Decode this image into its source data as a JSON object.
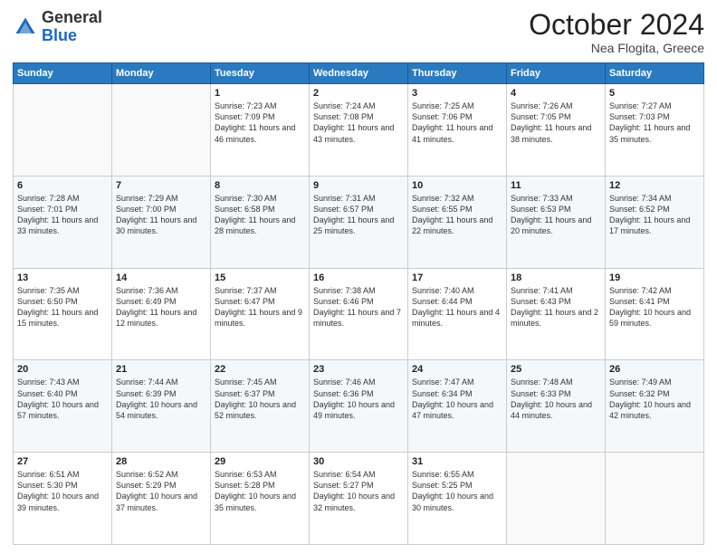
{
  "header": {
    "logo_general": "General",
    "logo_blue": "Blue",
    "month": "October 2024",
    "location": "Nea Flogita, Greece"
  },
  "weekdays": [
    "Sunday",
    "Monday",
    "Tuesday",
    "Wednesday",
    "Thursday",
    "Friday",
    "Saturday"
  ],
  "weeks": [
    [
      {
        "day": "",
        "info": ""
      },
      {
        "day": "",
        "info": ""
      },
      {
        "day": "1",
        "info": "Sunrise: 7:23 AM\nSunset: 7:09 PM\nDaylight: 11 hours and 46 minutes."
      },
      {
        "day": "2",
        "info": "Sunrise: 7:24 AM\nSunset: 7:08 PM\nDaylight: 11 hours and 43 minutes."
      },
      {
        "day": "3",
        "info": "Sunrise: 7:25 AM\nSunset: 7:06 PM\nDaylight: 11 hours and 41 minutes."
      },
      {
        "day": "4",
        "info": "Sunrise: 7:26 AM\nSunset: 7:05 PM\nDaylight: 11 hours and 38 minutes."
      },
      {
        "day": "5",
        "info": "Sunrise: 7:27 AM\nSunset: 7:03 PM\nDaylight: 11 hours and 35 minutes."
      }
    ],
    [
      {
        "day": "6",
        "info": "Sunrise: 7:28 AM\nSunset: 7:01 PM\nDaylight: 11 hours and 33 minutes."
      },
      {
        "day": "7",
        "info": "Sunrise: 7:29 AM\nSunset: 7:00 PM\nDaylight: 11 hours and 30 minutes."
      },
      {
        "day": "8",
        "info": "Sunrise: 7:30 AM\nSunset: 6:58 PM\nDaylight: 11 hours and 28 minutes."
      },
      {
        "day": "9",
        "info": "Sunrise: 7:31 AM\nSunset: 6:57 PM\nDaylight: 11 hours and 25 minutes."
      },
      {
        "day": "10",
        "info": "Sunrise: 7:32 AM\nSunset: 6:55 PM\nDaylight: 11 hours and 22 minutes."
      },
      {
        "day": "11",
        "info": "Sunrise: 7:33 AM\nSunset: 6:53 PM\nDaylight: 11 hours and 20 minutes."
      },
      {
        "day": "12",
        "info": "Sunrise: 7:34 AM\nSunset: 6:52 PM\nDaylight: 11 hours and 17 minutes."
      }
    ],
    [
      {
        "day": "13",
        "info": "Sunrise: 7:35 AM\nSunset: 6:50 PM\nDaylight: 11 hours and 15 minutes."
      },
      {
        "day": "14",
        "info": "Sunrise: 7:36 AM\nSunset: 6:49 PM\nDaylight: 11 hours and 12 minutes."
      },
      {
        "day": "15",
        "info": "Sunrise: 7:37 AM\nSunset: 6:47 PM\nDaylight: 11 hours and 9 minutes."
      },
      {
        "day": "16",
        "info": "Sunrise: 7:38 AM\nSunset: 6:46 PM\nDaylight: 11 hours and 7 minutes."
      },
      {
        "day": "17",
        "info": "Sunrise: 7:40 AM\nSunset: 6:44 PM\nDaylight: 11 hours and 4 minutes."
      },
      {
        "day": "18",
        "info": "Sunrise: 7:41 AM\nSunset: 6:43 PM\nDaylight: 11 hours and 2 minutes."
      },
      {
        "day": "19",
        "info": "Sunrise: 7:42 AM\nSunset: 6:41 PM\nDaylight: 10 hours and 59 minutes."
      }
    ],
    [
      {
        "day": "20",
        "info": "Sunrise: 7:43 AM\nSunset: 6:40 PM\nDaylight: 10 hours and 57 minutes."
      },
      {
        "day": "21",
        "info": "Sunrise: 7:44 AM\nSunset: 6:39 PM\nDaylight: 10 hours and 54 minutes."
      },
      {
        "day": "22",
        "info": "Sunrise: 7:45 AM\nSunset: 6:37 PM\nDaylight: 10 hours and 52 minutes."
      },
      {
        "day": "23",
        "info": "Sunrise: 7:46 AM\nSunset: 6:36 PM\nDaylight: 10 hours and 49 minutes."
      },
      {
        "day": "24",
        "info": "Sunrise: 7:47 AM\nSunset: 6:34 PM\nDaylight: 10 hours and 47 minutes."
      },
      {
        "day": "25",
        "info": "Sunrise: 7:48 AM\nSunset: 6:33 PM\nDaylight: 10 hours and 44 minutes."
      },
      {
        "day": "26",
        "info": "Sunrise: 7:49 AM\nSunset: 6:32 PM\nDaylight: 10 hours and 42 minutes."
      }
    ],
    [
      {
        "day": "27",
        "info": "Sunrise: 6:51 AM\nSunset: 5:30 PM\nDaylight: 10 hours and 39 minutes."
      },
      {
        "day": "28",
        "info": "Sunrise: 6:52 AM\nSunset: 5:29 PM\nDaylight: 10 hours and 37 minutes."
      },
      {
        "day": "29",
        "info": "Sunrise: 6:53 AM\nSunset: 5:28 PM\nDaylight: 10 hours and 35 minutes."
      },
      {
        "day": "30",
        "info": "Sunrise: 6:54 AM\nSunset: 5:27 PM\nDaylight: 10 hours and 32 minutes."
      },
      {
        "day": "31",
        "info": "Sunrise: 6:55 AM\nSunset: 5:25 PM\nDaylight: 10 hours and 30 minutes."
      },
      {
        "day": "",
        "info": ""
      },
      {
        "day": "",
        "info": ""
      }
    ]
  ]
}
